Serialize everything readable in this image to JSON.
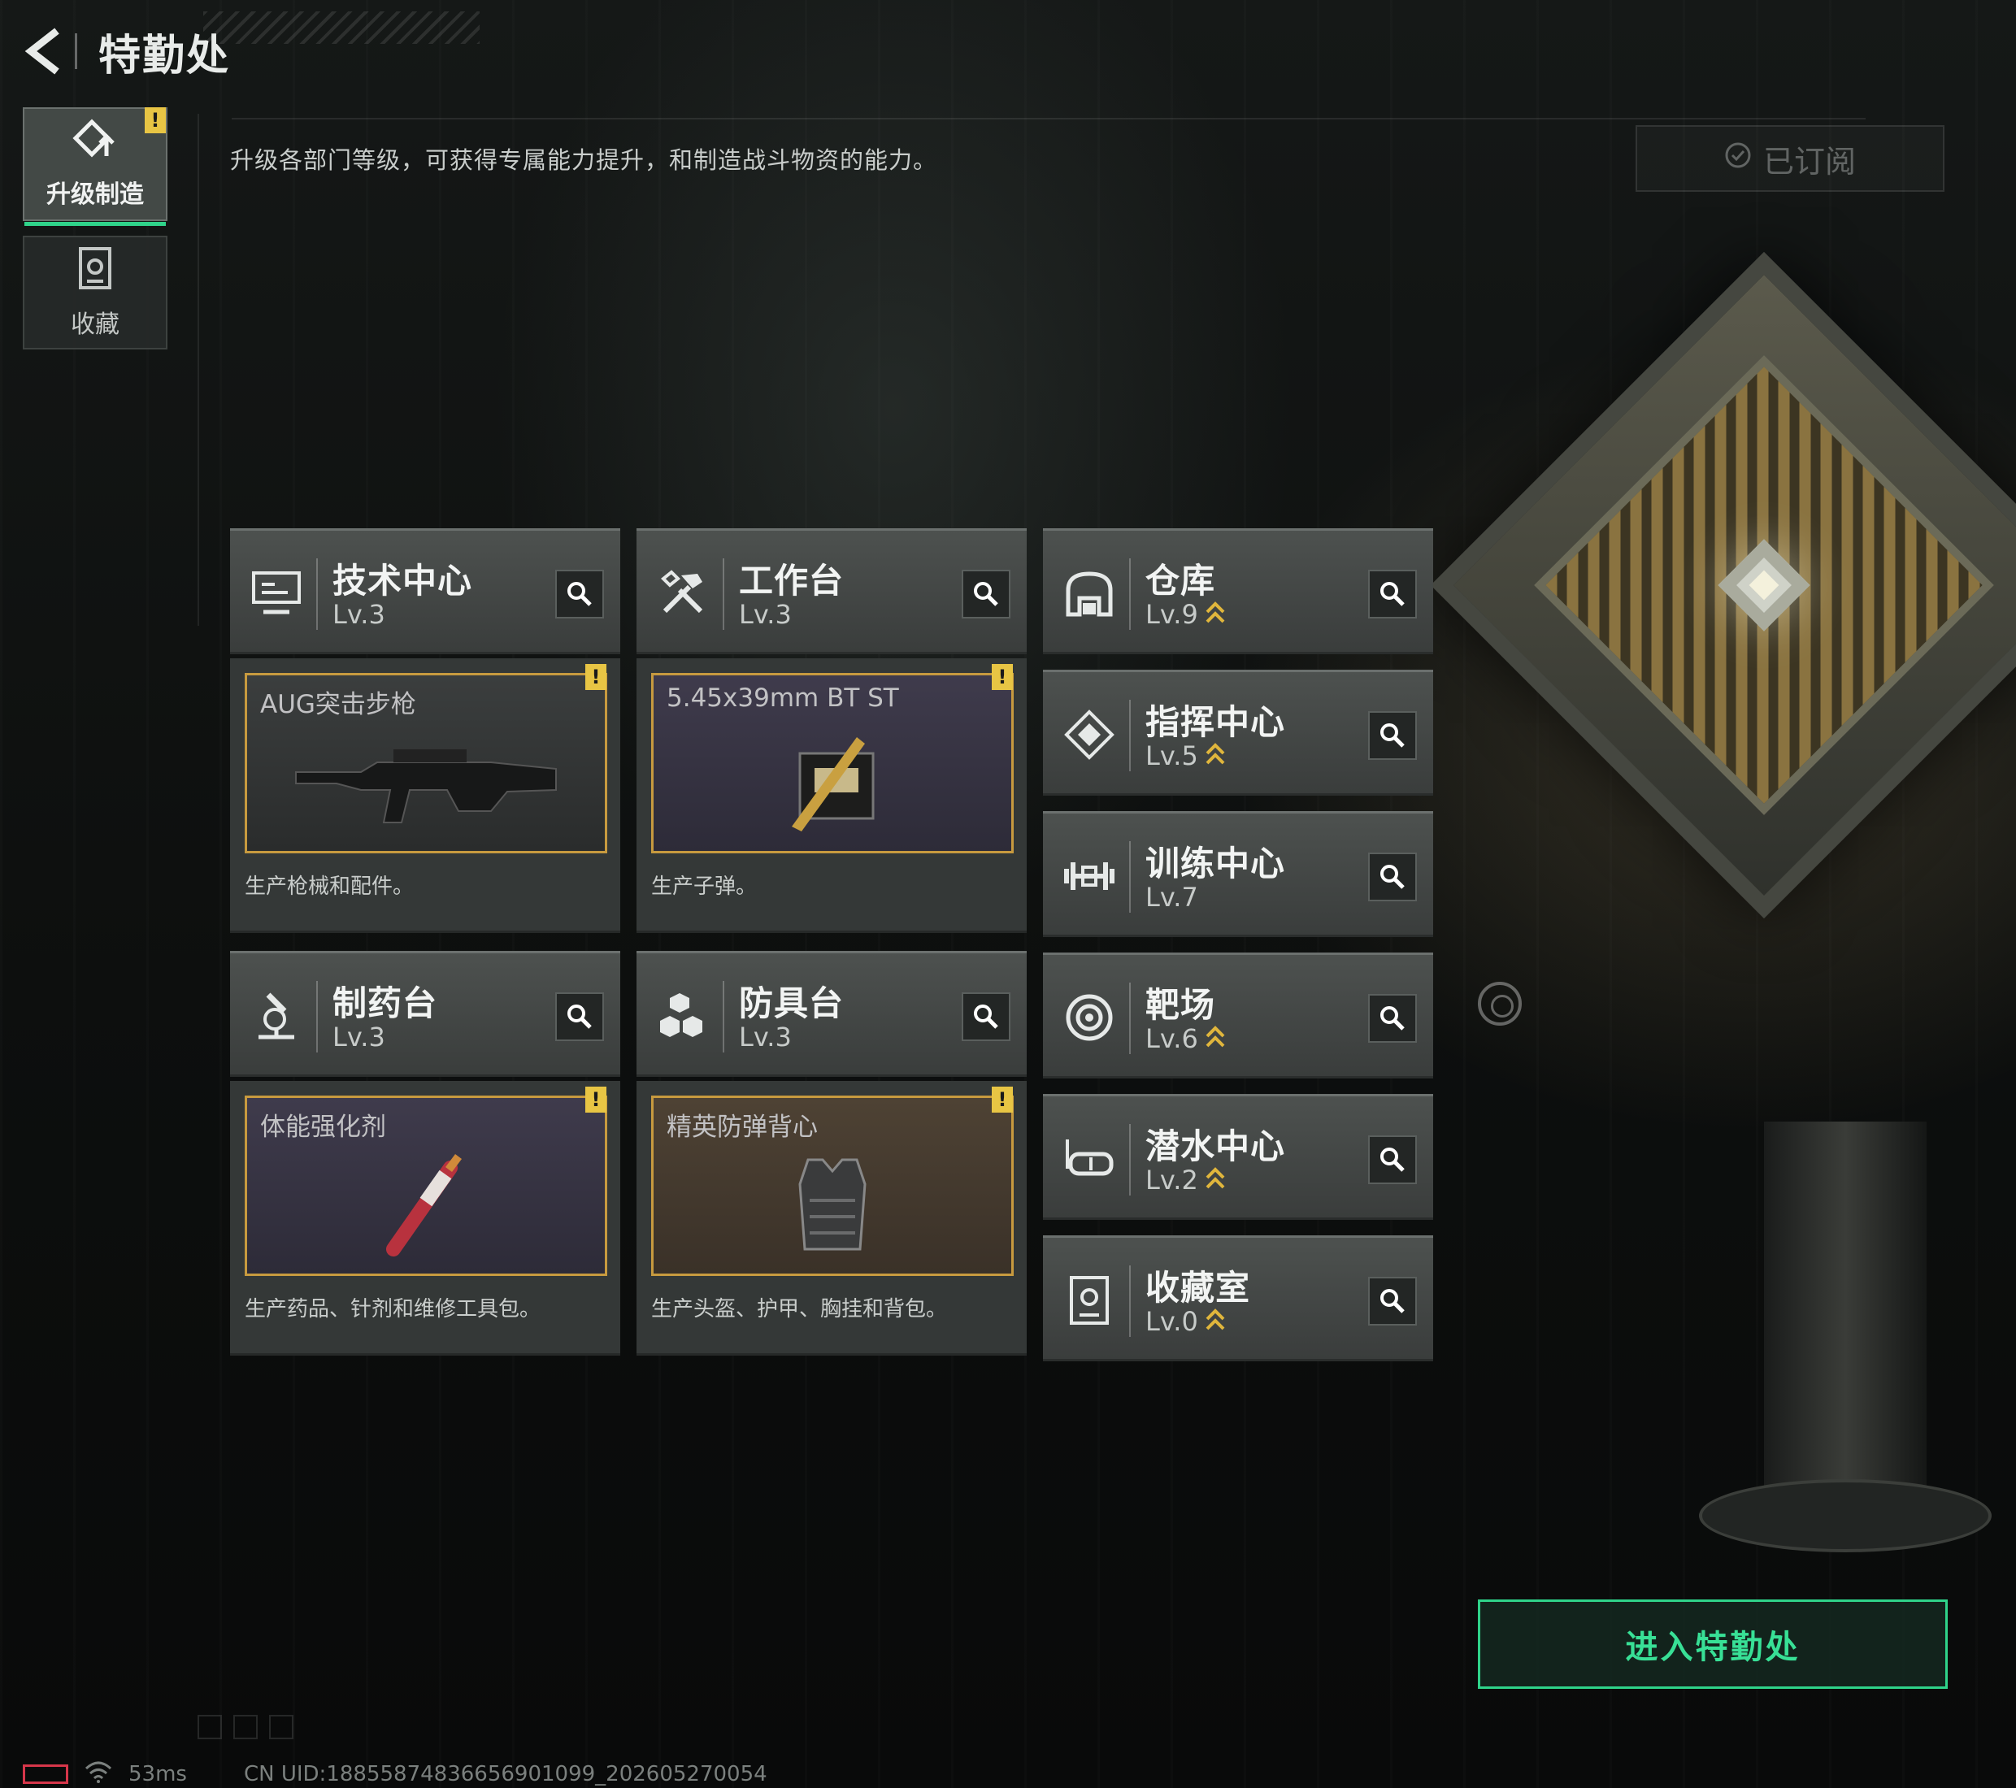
{
  "header": {
    "title": "特勤处"
  },
  "sidebar": {
    "items": [
      {
        "label": "升级制造",
        "icon": "upgrade-icon",
        "active": true,
        "alert": "!"
      },
      {
        "label": "收藏",
        "icon": "collection-icon",
        "active": false
      }
    ]
  },
  "description": "升级各部门等级，可获得专属能力提升，和制造战斗物资的能力。",
  "subscribed_label": "已订阅",
  "departments_with_items": [
    {
      "name": "技术中心",
      "level": "Lv.3",
      "icon": "monitor-icon",
      "item": "AUG突击步枪",
      "item_desc": "生产枪械和配件。",
      "alert": "!"
    },
    {
      "name": "工作台",
      "level": "Lv.3",
      "icon": "tools-icon",
      "item": "5.45x39mm BT ST",
      "item_desc": "生产子弹。",
      "alert": "!"
    },
    {
      "name": "制药台",
      "level": "Lv.3",
      "icon": "microscope-icon",
      "item": "体能强化剂",
      "item_desc": "生产药品、针剂和维修工具包。",
      "alert": "!"
    },
    {
      "name": "防具台",
      "level": "Lv.3",
      "icon": "armor-blocks-icon",
      "item": "精英防弹背心",
      "item_desc": "生产头盔、护甲、胸挂和背包。",
      "alert": "!"
    }
  ],
  "departments_simple": [
    {
      "name": "仓库",
      "level": "Lv.9",
      "icon": "warehouse-icon",
      "upgradable": true
    },
    {
      "name": "指挥中心",
      "level": "Lv.5",
      "icon": "command-icon",
      "upgradable": true
    },
    {
      "name": "训练中心",
      "level": "Lv.7",
      "icon": "dumbbell-icon",
      "upgradable": false
    },
    {
      "name": "靶场",
      "level": "Lv.6",
      "icon": "target-icon",
      "upgradable": true
    },
    {
      "name": "潜水中心",
      "level": "Lv.2",
      "icon": "diving-mask-icon",
      "upgradable": true
    },
    {
      "name": "收藏室",
      "level": "Lv.0",
      "icon": "collection-room-icon",
      "upgradable": true
    }
  ],
  "enter_button": "进入特勤处",
  "status": {
    "ping": "53ms",
    "uid": "CN UID:18855874836656901099_202605270054"
  },
  "colors": {
    "accent_green": "#2fd38a",
    "alert_yellow": "#e8c544",
    "item_border": "#c79a3f"
  }
}
